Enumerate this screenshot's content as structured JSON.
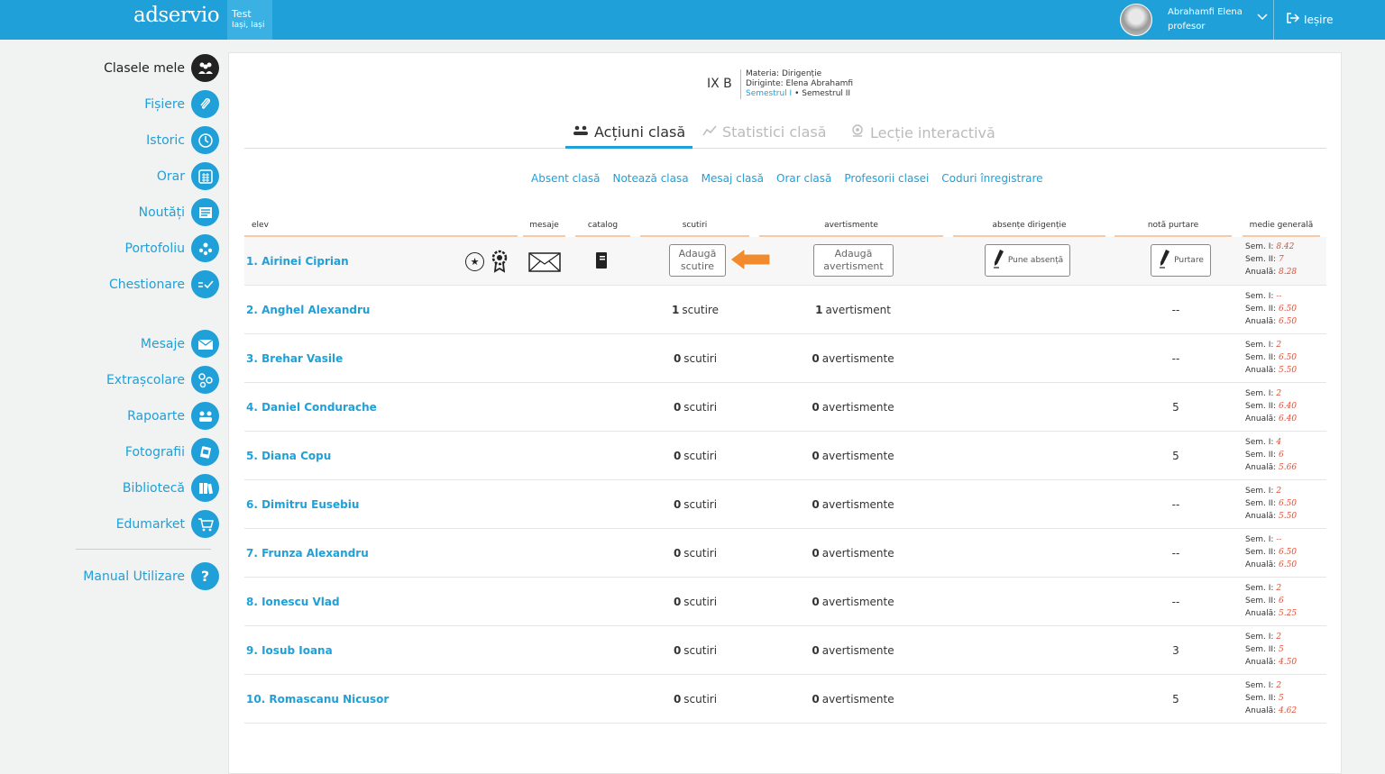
{
  "topbar": {
    "logo": "adservio",
    "school_name": "Test",
    "school_city": "Iași, Iași",
    "user_name": "Abrahamfi Elena",
    "user_role": "profesor",
    "logout_label": "Ieșire"
  },
  "sidebar": {
    "items": [
      {
        "label": "Clasele mele",
        "icon": "classes-icon"
      },
      {
        "label": "Fișiere",
        "icon": "paperclip-icon"
      },
      {
        "label": "Istoric",
        "icon": "history-icon"
      },
      {
        "label": "Orar",
        "icon": "calendar-icon"
      },
      {
        "label": "Noutăți",
        "icon": "news-icon"
      },
      {
        "label": "Portofoliu",
        "icon": "portfolio-icon"
      },
      {
        "label": "Chestionare",
        "icon": "checklist-icon"
      },
      {
        "label": "Mesaje",
        "icon": "envelope-icon"
      },
      {
        "label": "Extrașcolare",
        "icon": "activities-icon"
      },
      {
        "label": "Rapoarte",
        "icon": "reports-icon"
      },
      {
        "label": "Fotografii",
        "icon": "photos-icon"
      },
      {
        "label": "Bibliotecă",
        "icon": "library-icon"
      },
      {
        "label": "Edumarket",
        "icon": "cart-icon"
      },
      {
        "label": "Manual Utilizare",
        "icon": "help-icon"
      }
    ]
  },
  "class_header": {
    "name": "IX B",
    "subject": "Materia: Dirigenție",
    "head_teacher": "Diriginte: Elena Abrahamfi",
    "semester_1": "Semestrul I",
    "semester_sep": " • ",
    "semester_2": "Semestrul II"
  },
  "tabs": [
    {
      "label": "Acțiuni clasă",
      "active": true
    },
    {
      "label": "Statistici clasă",
      "active": false
    },
    {
      "label": "Lecție interactivă",
      "active": false
    }
  ],
  "actions": [
    "Absent clasă",
    "Notează clasa",
    "Mesaj clasă",
    "Orar clasă",
    "Profesorii clasei",
    "Coduri înregistrare"
  ],
  "table": {
    "headers": {
      "elev": "elev",
      "mesaje": "mesaje",
      "catalog": "catalog",
      "scutiri": "scutiri",
      "avertismente": "avertismente",
      "absente": "absențe dirigenție",
      "purtare": "notă purtare",
      "medii": "medie generală"
    },
    "first_row_buttons": {
      "add_exemption_l1": "Adaugă",
      "add_exemption_l2": "scutire",
      "add_warning_l1": "Adaugă",
      "add_warning_l2": "avertisment",
      "mark_absence": "Pune absență",
      "conduct": "Purtare"
    },
    "avg_labels": {
      "sem1": "Sem. I:",
      "sem2": "Sem. II:",
      "annual": "Anuală:"
    },
    "rows": [
      {
        "name": "1. Airinei Ciprian",
        "scutiri_n": "",
        "scutiri_t": "",
        "avert_n": "",
        "avert_t": "",
        "purtare": "",
        "sem1": "8.42",
        "sem2": "7",
        "annual": "8.28"
      },
      {
        "name": "2. Anghel Alexandru",
        "scutiri_n": "1",
        "scutiri_t": "scutire",
        "avert_n": "1",
        "avert_t": "avertisment",
        "purtare": "--",
        "sem1": "--",
        "sem2": "6.50",
        "annual": "6.50"
      },
      {
        "name": "3. Brehar Vasile",
        "scutiri_n": "0",
        "scutiri_t": "scutiri",
        "avert_n": "0",
        "avert_t": "avertismente",
        "purtare": "--",
        "sem1": "2",
        "sem2": "6.50",
        "annual": "5.50"
      },
      {
        "name": "4. Daniel Condurache",
        "scutiri_n": "0",
        "scutiri_t": "scutiri",
        "avert_n": "0",
        "avert_t": "avertismente",
        "purtare": "5",
        "sem1": "2",
        "sem2": "6.40",
        "annual": "6.40"
      },
      {
        "name": "5. Diana Copu",
        "scutiri_n": "0",
        "scutiri_t": "scutiri",
        "avert_n": "0",
        "avert_t": "avertismente",
        "purtare": "5",
        "sem1": "4",
        "sem2": "6",
        "annual": "5.66"
      },
      {
        "name": "6. Dimitru Eusebiu",
        "scutiri_n": "0",
        "scutiri_t": "scutiri",
        "avert_n": "0",
        "avert_t": "avertismente",
        "purtare": "--",
        "sem1": "2",
        "sem2": "6.50",
        "annual": "5.50"
      },
      {
        "name": "7. Frunza Alexandru",
        "scutiri_n": "0",
        "scutiri_t": "scutiri",
        "avert_n": "0",
        "avert_t": "avertismente",
        "purtare": "--",
        "sem1": "--",
        "sem2": "6.50",
        "annual": "6.50"
      },
      {
        "name": "8. Ionescu Vlad",
        "scutiri_n": "0",
        "scutiri_t": "scutiri",
        "avert_n": "0",
        "avert_t": "avertismente",
        "purtare": "--",
        "sem1": "2",
        "sem2": "6",
        "annual": "5.25"
      },
      {
        "name": "9. Iosub Ioana",
        "scutiri_n": "0",
        "scutiri_t": "scutiri",
        "avert_n": "0",
        "avert_t": "avertismente",
        "purtare": "3",
        "sem1": "2",
        "sem2": "5",
        "annual": "4.50"
      },
      {
        "name": "10. Romascanu Nicusor",
        "scutiri_n": "0",
        "scutiri_t": "scutiri",
        "avert_n": "0",
        "avert_t": "avertismente",
        "purtare": "5",
        "sem1": "2",
        "sem2": "5",
        "annual": "4.62"
      }
    ]
  },
  "colors": {
    "accent": "#1fa0d8",
    "header_underline": "#f9c9a5",
    "grade": "#e04b33",
    "arrow": "#f28a2e"
  }
}
